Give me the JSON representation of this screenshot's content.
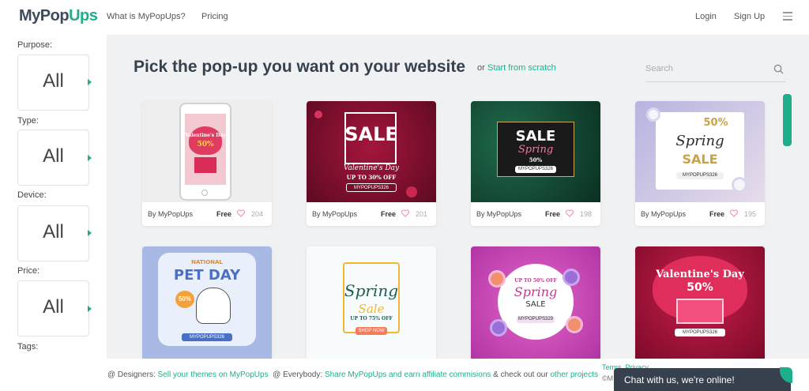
{
  "nav": {
    "logo_main": "MyPop",
    "logo_accent": "Ups",
    "links": [
      "What is MyPopUps?",
      "Pricing"
    ],
    "login": "Login",
    "signup": "Sign Up"
  },
  "sidebar": {
    "filters": [
      {
        "label": "Purpose:",
        "value": "All"
      },
      {
        "label": "Type:",
        "value": "All"
      },
      {
        "label": "Device:",
        "value": "All"
      },
      {
        "label": "Price:",
        "value": "All"
      }
    ],
    "tags_label": "Tags:"
  },
  "main": {
    "headline": "Pick the pop-up you want on your website",
    "or_text": "or",
    "scratch_link": "Start from scratch",
    "search_placeholder": "Search"
  },
  "cards": [
    {
      "author": "By MyPopUps",
      "price": "Free",
      "likes": "204",
      "thumb": {
        "line1": "Valentine's Day",
        "line2": "50%"
      }
    },
    {
      "author": "By MyPopUps",
      "price": "Free",
      "likes": "201",
      "thumb": {
        "line1": "SALE",
        "line2": "Valentine's Day",
        "line3": "UP TO 30% OFF",
        "code": "MYPOPUPS326"
      }
    },
    {
      "author": "By MyPopUps",
      "price": "Free",
      "likes": "198",
      "thumb": {
        "line1": "SALE",
        "line2": "Spring",
        "line3": "50%",
        "code": "MYPOPUPS326"
      }
    },
    {
      "author": "By MyPopUps",
      "price": "Free",
      "likes": "195",
      "thumb": {
        "line1": "50%",
        "line2": "Spring",
        "line3": "SALE",
        "code": "MYPOPUPS326"
      }
    },
    {
      "thumb": {
        "line1": "NATIONAL",
        "line2": "PET DAY",
        "line3": "50%",
        "code": "MYPOPUPS326"
      }
    },
    {
      "thumb": {
        "line1": "Spring",
        "line2": "Sale",
        "line3": "UP TO 75% OFF",
        "code": "SHOP NOW"
      }
    },
    {
      "thumb": {
        "line1": "UP TO 50% OFF",
        "line2": "Spring",
        "line3": "SALE",
        "code": "MYPOPUPS329"
      }
    },
    {
      "thumb": {
        "line1": "Valentine's Day",
        "line2": "50%",
        "code": "MYPOPUPS326"
      }
    }
  ],
  "footer": {
    "designers_prefix": "@ Designers:",
    "designers_link": "Sell your themes on MyPopUps",
    "everybody_prefix": "@ Everybody:",
    "everybody_link": "Share MyPopUps and earn affiliate commisions",
    "middle_text": "& check out our",
    "other_link": "other projects",
    "terms": "Terms",
    "privacy": "Privacy",
    "copy": "©M",
    "chat": "Chat with us, we're online!"
  },
  "colors": {
    "accent": "#1fae8c",
    "dark": "#37414d"
  }
}
